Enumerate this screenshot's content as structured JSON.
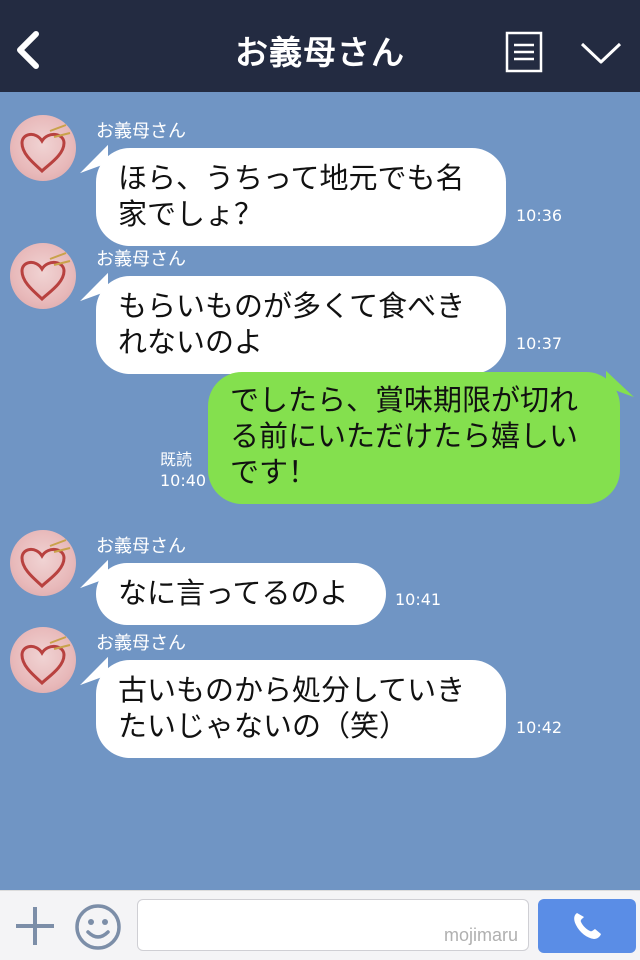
{
  "header": {
    "title": "お義母さん",
    "back_icon": "back-arrow-icon",
    "menu_icon": "menu-list-icon",
    "dropdown_icon": "chevron-down-icon",
    "background": "#232b41"
  },
  "chat": {
    "background": "#7095c4",
    "messages": [
      {
        "sender": "お義母さん",
        "line1": "ほら、うちって地元でも名",
        "line2": "家でしょ？",
        "time": "10:36"
      },
      {
        "sender": "お義母さん",
        "line1": "もらいものが多くて食べき",
        "line2": "れないのよ",
        "time": "10:37"
      },
      {
        "read_label": "既読",
        "time": "10:40",
        "line1": "でしたら、賞味期限が切れ",
        "line2": "る前にいただけたら嬉しい",
        "line3": "です！"
      },
      {
        "sender": "お義母さん",
        "line1": "なに言ってるのよ",
        "time": "10:41"
      },
      {
        "sender": "お義母さん",
        "line1": "古いものから処分していき",
        "line2": "たいじゃないの（笑）",
        "time": "10:42"
      }
    ],
    "outgoing_color": "#84e04e",
    "incoming_color": "#ffffff"
  },
  "bottom_bar": {
    "plus_icon": "plus-icon",
    "sticker_icon": "smiley-icon",
    "input_value": "",
    "watermark": "mojimaru",
    "call_icon": "phone-icon",
    "call_color": "#5a8de6"
  }
}
